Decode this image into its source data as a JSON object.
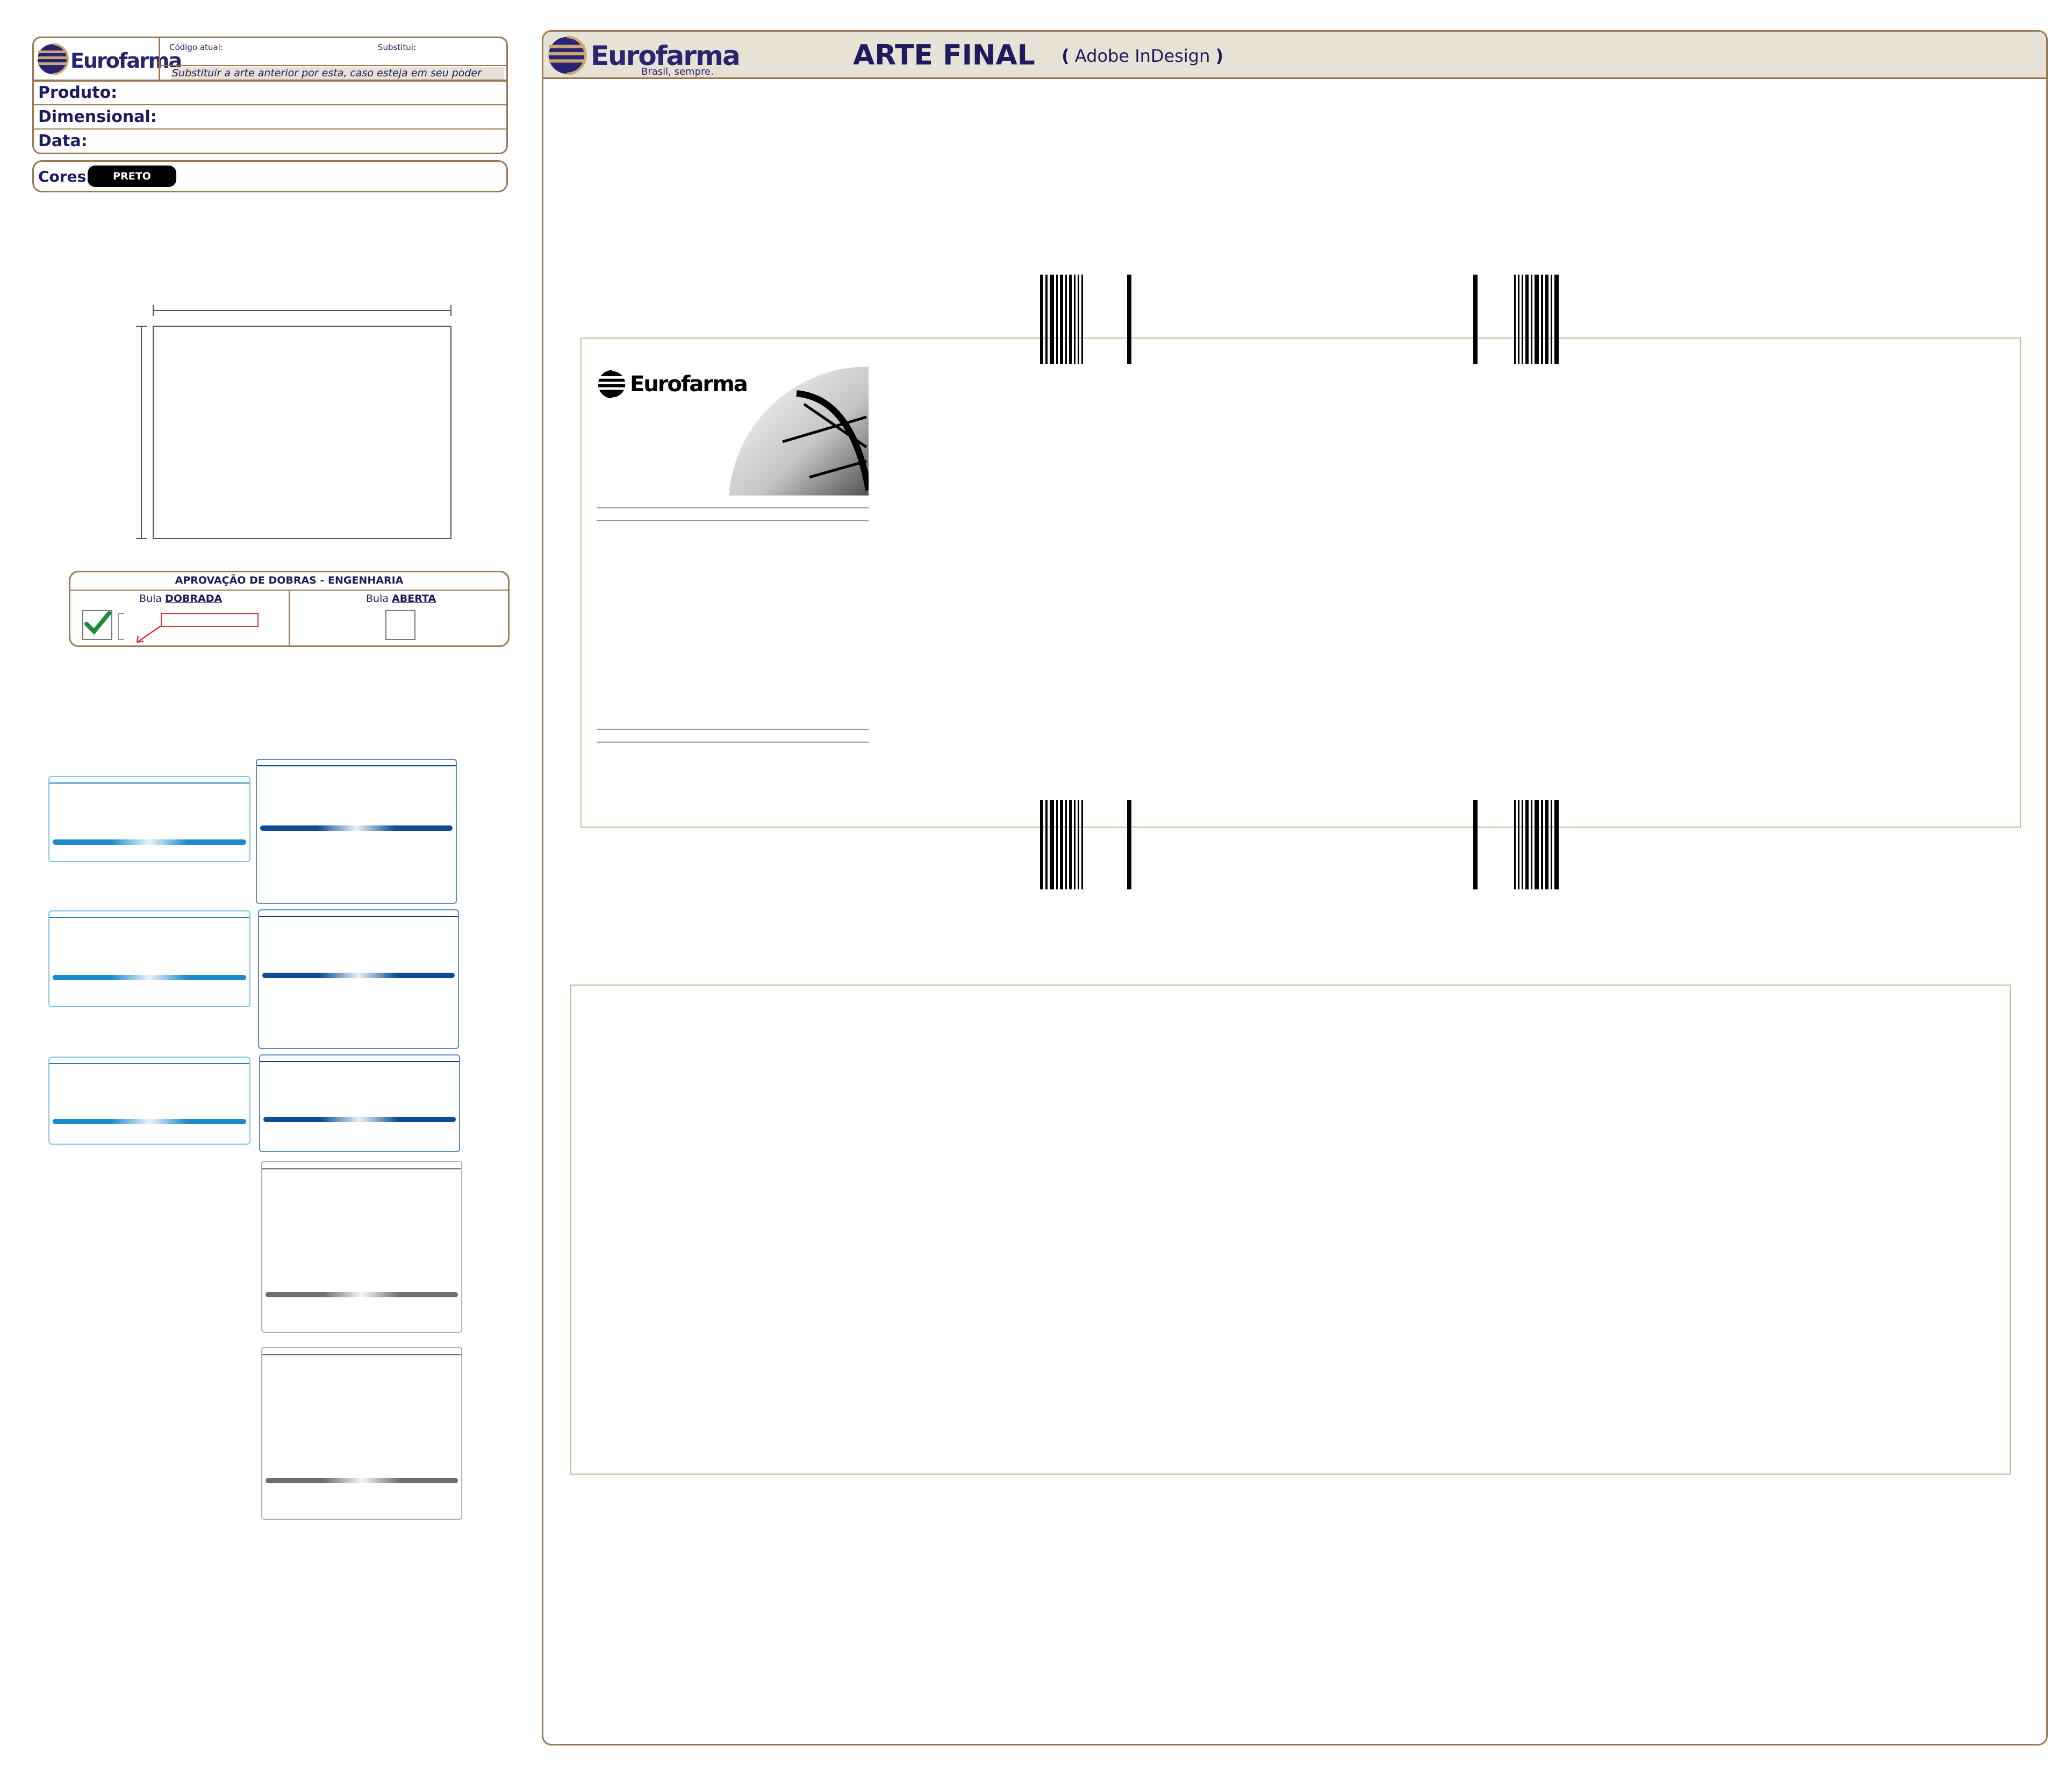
{
  "brand": {
    "name": "Eurofarma",
    "tagline": "Brasil, sempre."
  },
  "info_panel": {
    "codigo_atual_label": "Código atual:",
    "substitui_label": "Substitui:",
    "notice": "Substituir a arte anterior por esta, caso esteja em seu poder",
    "produto_label": "Produto:",
    "dimensional_label": "Dimensional:",
    "data_label": "Data:",
    "cores_label": "Cores:",
    "color_chip": "PRETO"
  },
  "approval": {
    "title": "APROVAÇÃO DE DOBRAS - ENGENHARIA",
    "folded_prefix": "Bula",
    "folded_word": "DOBRADA",
    "open_prefix": "Bula",
    "open_word": "ABERTA"
  },
  "header": {
    "title": "ARTE FINAL",
    "software_open": "(",
    "software": "Adobe InDesign",
    "software_close": ")"
  },
  "colors": {
    "frame": "#9a7a55",
    "header_bg": "#e8e2d6",
    "navy": "#1f1a5e",
    "chip_bg": "#000000",
    "check_green": "#1e8a3c",
    "callout_red": "#e0303a",
    "light_blue": "#1a8acb",
    "dark_blue": "#0d4d95"
  },
  "icons": [
    "eurofarma-globe-logo",
    "check-icon",
    "arrow-icon",
    "barcode-icon"
  ]
}
